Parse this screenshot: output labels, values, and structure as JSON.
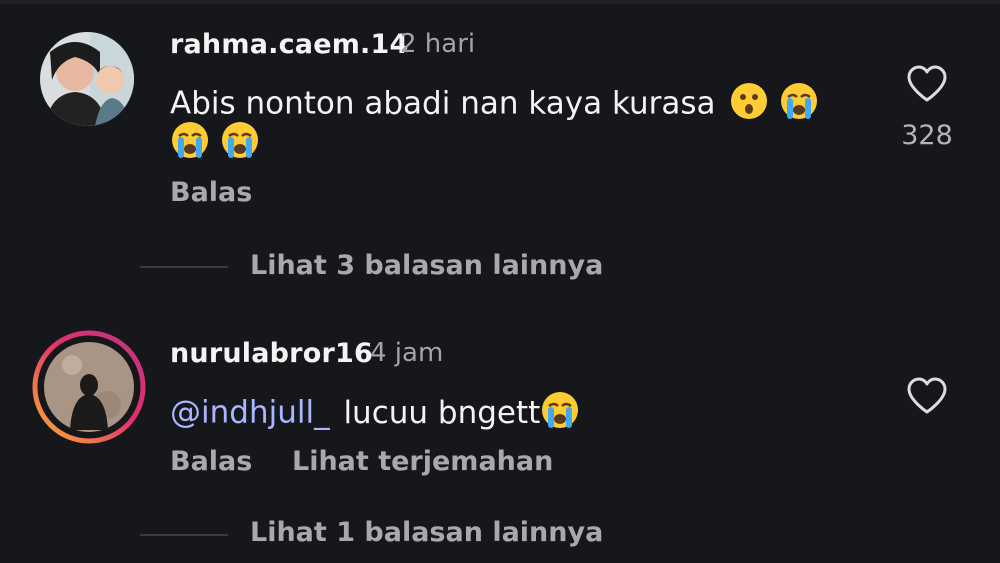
{
  "comments": [
    {
      "username": "rahma.caem.14",
      "time": "2 hari",
      "text_line1": "Abis nonton abadi nan kaya kurasa",
      "reply_label": "Balas",
      "like_count": "328",
      "more_replies": "Lihat 3 balasan lainnya"
    },
    {
      "username": "nurulabror16",
      "time": "4 jam",
      "mention": "@indhjull_",
      "text": "lucuu bngett",
      "reply_label": "Balas",
      "translate_label": "Lihat terjemahan",
      "more_replies": "Lihat 1 balasan lainnya"
    }
  ],
  "colors": {
    "background": "#16171b",
    "mention": "#a9b6ff",
    "story_ring_start": "#f9b233",
    "story_ring_end": "#c13584"
  }
}
